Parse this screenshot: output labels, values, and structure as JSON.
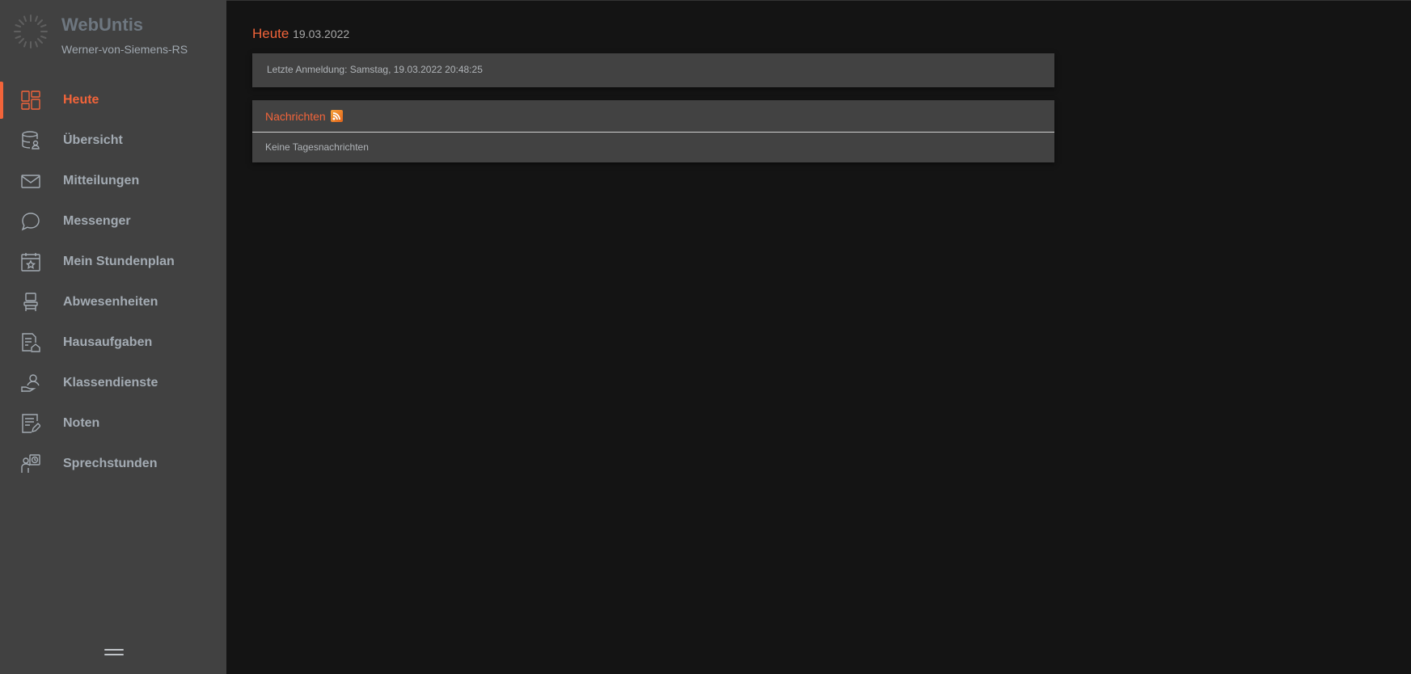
{
  "app": {
    "title": "WebUntis",
    "school": "Werner-von-Siemens-RS"
  },
  "nav": [
    {
      "label": "Heute",
      "icon": "dashboard-icon",
      "active": true
    },
    {
      "label": "Übersicht",
      "icon": "database-user-icon"
    },
    {
      "label": "Mitteilungen",
      "icon": "envelope-icon"
    },
    {
      "label": "Messenger",
      "icon": "chat-bubble-icon"
    },
    {
      "label": "Mein Stundenplan",
      "icon": "calendar-star-icon"
    },
    {
      "label": "Abwesenheiten",
      "icon": "chair-icon"
    },
    {
      "label": "Hausaufgaben",
      "icon": "document-home-icon"
    },
    {
      "label": "Klassendienste",
      "icon": "person-hand-icon"
    },
    {
      "label": "Noten",
      "icon": "document-edit-icon"
    },
    {
      "label": "Sprechstunden",
      "icon": "person-clock-icon"
    }
  ],
  "main": {
    "title": "Heute",
    "date": "19.03.2022",
    "last_login": "Letzte Anmeldung: Samstag, 19.03.2022 20:48:25",
    "news_title": "Nachrichten",
    "news_empty": "Keine Tagesnachrichten"
  },
  "colors": {
    "accent": "#f2643a",
    "sidebar": "#414141",
    "background": "#141414"
  }
}
